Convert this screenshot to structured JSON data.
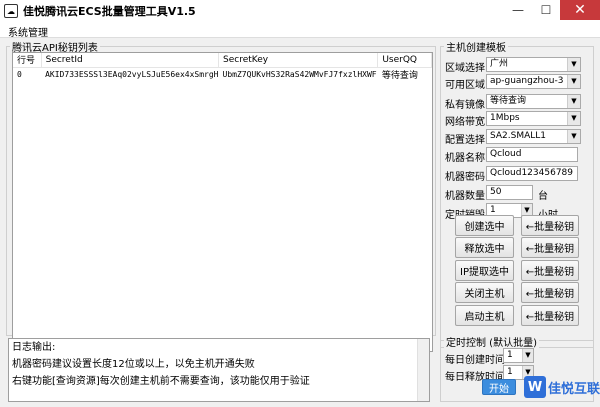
{
  "window": {
    "title": "佳悦腾讯云ECS批量管理工具V1.5",
    "minimize": "—",
    "maximize": "☐",
    "close": "✕"
  },
  "menu": {
    "system": "系统管理"
  },
  "keys": {
    "group_label": "腾讯云API秘钥列表",
    "columns": [
      "行号",
      "SecretId",
      "SecretKey",
      "UserQQ"
    ],
    "rows": [
      {
        "row": "0",
        "secret_id": "AKID733ESSSl3EAq02vyLSJuE56ex4xSmrgH",
        "secret_key": "UbmZ7QUKvHS32RaS42WMvFJ7fxzlHXWF",
        "user_qq": "等待查询"
      }
    ]
  },
  "log": {
    "title": "日志输出:",
    "lines": [
      "机器密码建议设置长度12位或以上，以免主机开通失败",
      "右键功能[查询资源]每次创建主机前不需要查询，该功能仅用于验证"
    ]
  },
  "template": {
    "group_label": "主机创建模板",
    "region_label": "区域选择:",
    "region_value": "广州",
    "zone_label": "可用区域:",
    "zone_value": "ap-guangzhou-3",
    "image_label": "私有镜像:",
    "image_value": "等待查询",
    "bandwidth_label": "网络带宽:",
    "bandwidth_value": "1Mbps",
    "config_label": "配置选择:",
    "config_value": "SA2.SMALL1",
    "name_label": "机器名称:",
    "name_value": "Qcloud",
    "password_label": "机器密码:",
    "password_value": "Qcloud123456789",
    "count_label": "机器数量:",
    "count_value": "50",
    "count_unit": "台",
    "timer_label": "定时销毁:",
    "timer_value": "1",
    "timer_unit": "小时"
  },
  "actions": {
    "create_selected": "创建选中",
    "release_selected": "释放选中",
    "ip_selected": "IP提取选中",
    "shutdown": "关闭主机",
    "start": "启动主机",
    "batch_key": "←批量秘钥"
  },
  "schedule": {
    "group_label": "定时控制 (默认批量)",
    "create_label": "每日创建时间:",
    "create_value": "1",
    "release_label": "每日释放时间:",
    "release_value": "1",
    "start_button": "开始"
  },
  "watermark": {
    "logo": "W",
    "text": "佳悦互联"
  }
}
